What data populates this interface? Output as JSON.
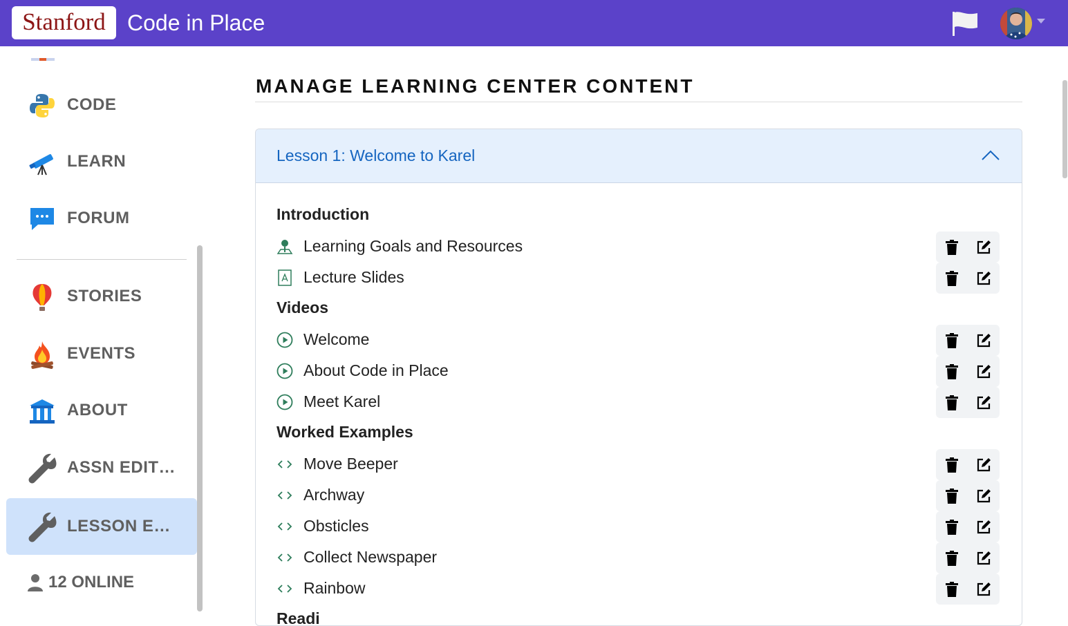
{
  "header": {
    "logo_text": "Stanford",
    "app_title": "Code in Place",
    "brand_color": "#5b42c9",
    "flag_icon": "flag-icon",
    "avatar_icon": "user-avatar"
  },
  "sidebar": {
    "items": [
      {
        "label": "CODE",
        "icon": "python-icon"
      },
      {
        "label": "LEARN",
        "icon": "telescope-icon"
      },
      {
        "label": "FORUM",
        "icon": "chat-bubble-icon"
      },
      {
        "label": "STORIES",
        "icon": "balloon-icon"
      },
      {
        "label": "EVENTS",
        "icon": "campfire-icon"
      },
      {
        "label": "ABOUT",
        "icon": "building-icon"
      },
      {
        "label": "ASSN EDIT…",
        "icon": "wrench-icon"
      },
      {
        "label": "LESSON E…",
        "icon": "wrench-icon",
        "active": true
      }
    ],
    "online": "12 ONLINE"
  },
  "main": {
    "page_title": "MANAGE LEARNING CENTER CONTENT",
    "lesson": {
      "title": "Lesson 1: Welcome to Karel",
      "sections": [
        {
          "title": "Introduction",
          "items": [
            {
              "label": "Learning Goals and Resources",
              "icon": "goal-pin-icon"
            },
            {
              "label": "Lecture Slides",
              "icon": "pdf-file-icon"
            }
          ]
        },
        {
          "title": "Videos",
          "items": [
            {
              "label": "Welcome",
              "icon": "play-circle-icon"
            },
            {
              "label": "About Code in Place",
              "icon": "play-circle-icon"
            },
            {
              "label": "Meet Karel",
              "icon": "play-circle-icon"
            }
          ]
        },
        {
          "title": "Worked Examples",
          "items": [
            {
              "label": "Move Beeper",
              "icon": "code-brackets-icon"
            },
            {
              "label": "Archway",
              "icon": "code-brackets-icon"
            },
            {
              "label": "Obsticles",
              "icon": "code-brackets-icon"
            },
            {
              "label": "Collect Newspaper",
              "icon": "code-brackets-icon"
            },
            {
              "label": "Rainbow",
              "icon": "code-brackets-icon"
            }
          ]
        },
        {
          "title": "Readi",
          "items": []
        }
      ]
    }
  }
}
